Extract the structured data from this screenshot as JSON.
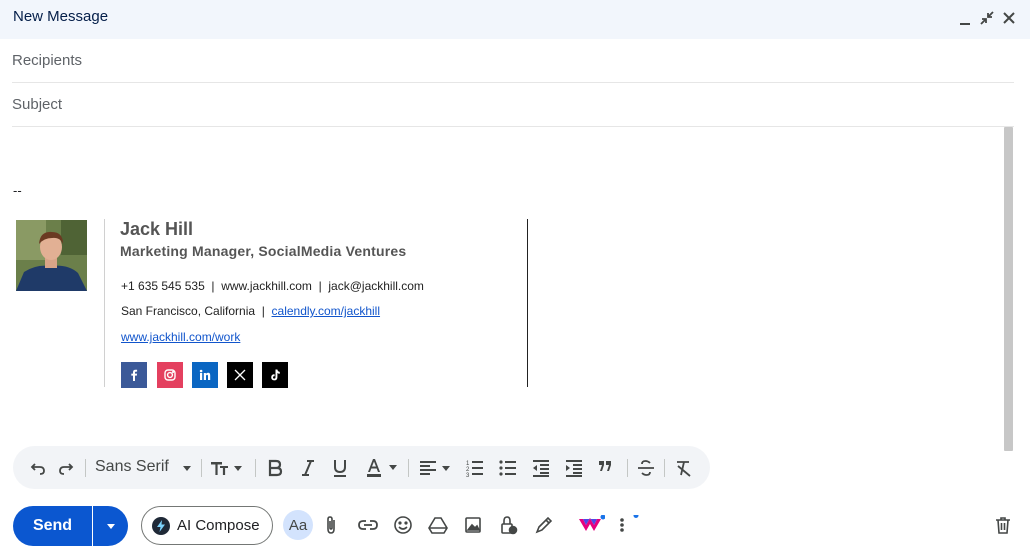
{
  "window": {
    "title": "New Message"
  },
  "fields": {
    "recipients_placeholder": "Recipients",
    "subject_placeholder": "Subject"
  },
  "body": {
    "separator": "--"
  },
  "signature": {
    "name": "Jack Hill",
    "role": "Marketing Manager, SocialMedia Ventures",
    "phone": "+1 635 545 535",
    "website": "www.jackhill.com",
    "email": "jack@jackhill.com",
    "location": "San Francisco, California",
    "calendly": "calendly.com/jackhill",
    "work_link": "www.jackhill.com/work",
    "divider": "|",
    "social": [
      "facebook",
      "instagram",
      "linkedin",
      "x",
      "tiktok"
    ]
  },
  "toolbar": {
    "font": "Sans Serif"
  },
  "actions": {
    "send": "Send",
    "ai_compose": "AI Compose",
    "formatting": "Aa"
  },
  "colors": {
    "send": "#0b57d0",
    "titlebar": "#f2f6fc",
    "facebook": "#3b5998",
    "instagram": "#e4405f",
    "linkedin": "#0a66c2"
  }
}
